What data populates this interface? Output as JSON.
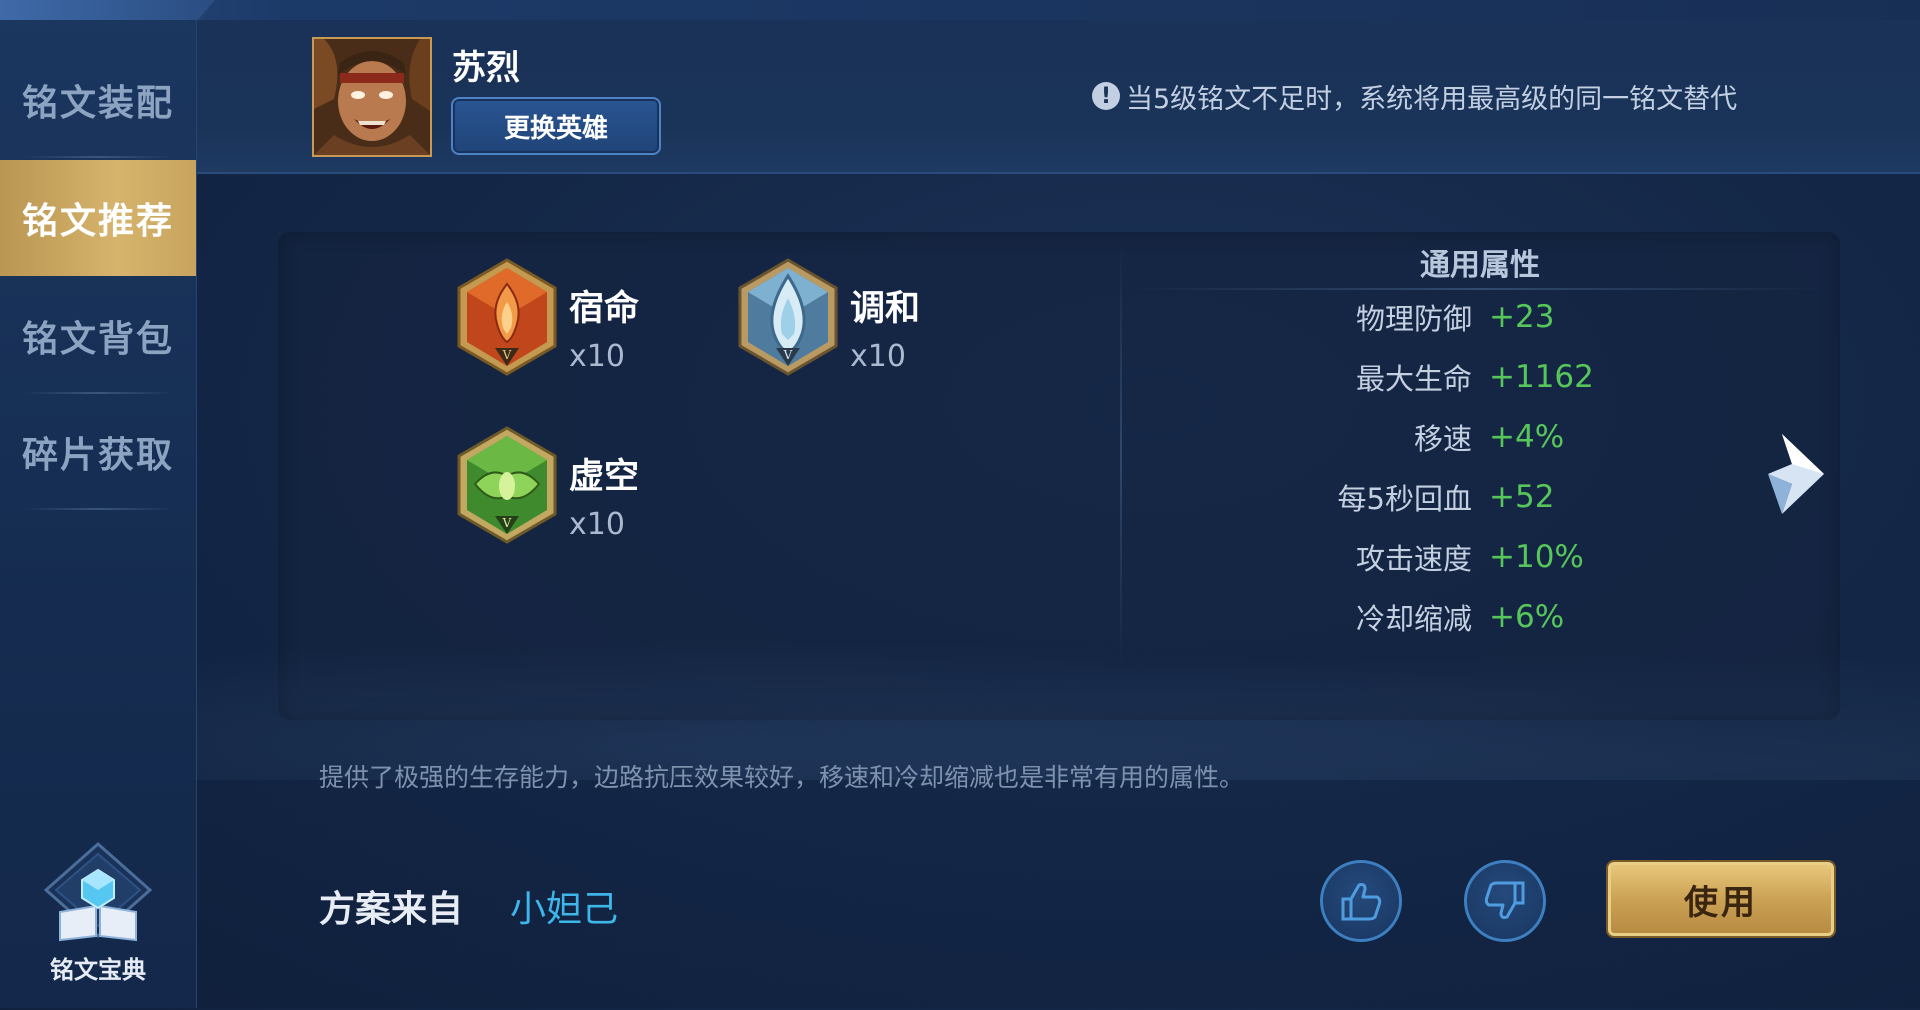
{
  "sidebar": {
    "items": [
      {
        "label": "铭文装配",
        "active": false
      },
      {
        "label": "铭文推荐",
        "active": true
      },
      {
        "label": "铭文背包",
        "active": false
      },
      {
        "label": "碎片获取",
        "active": false
      }
    ],
    "codex_label": "铭文宝典",
    "codex_icon": "book-crystal-icon"
  },
  "header": {
    "hero_name": "苏烈",
    "change_hero_label": "更换英雄",
    "notice_text": "当5级铭文不足时，系统将用最高级的同一铭文替代",
    "notice_icon": "exclamation-icon"
  },
  "runes": [
    {
      "name": "宿命",
      "count": "x10",
      "color": "#d2521e",
      "icon": "flame-rune-icon"
    },
    {
      "name": "调和",
      "count": "x10",
      "color": "#6aa7c9",
      "icon": "teardrop-rune-icon"
    },
    {
      "name": "虚空",
      "count": "x10",
      "color": "#5aa23c",
      "icon": "leaf-rune-icon"
    }
  ],
  "attributes": {
    "title": "通用属性",
    "rows": [
      {
        "name": "物理防御",
        "value": "+23"
      },
      {
        "name": "最大生命",
        "value": "+1162"
      },
      {
        "name": "移速",
        "value": "+4%"
      },
      {
        "name": "每5秒回血",
        "value": "+52"
      },
      {
        "name": "攻击速度",
        "value": "+10%"
      },
      {
        "name": "冷却缩减",
        "value": "+6%"
      }
    ]
  },
  "description": "提供了极强的生存能力，边路抗压效果较好，移速和冷却缩减也是非常有用的属性。",
  "source": {
    "label": "方案来自",
    "author": "小妲己"
  },
  "actions": {
    "like_icon": "thumbs-up-icon",
    "dislike_icon": "thumbs-down-icon",
    "use_label": "使用"
  },
  "colors": {
    "accent_gold": "#d6b46c",
    "value_green": "#56c65b",
    "link_blue": "#3fb6ea"
  }
}
